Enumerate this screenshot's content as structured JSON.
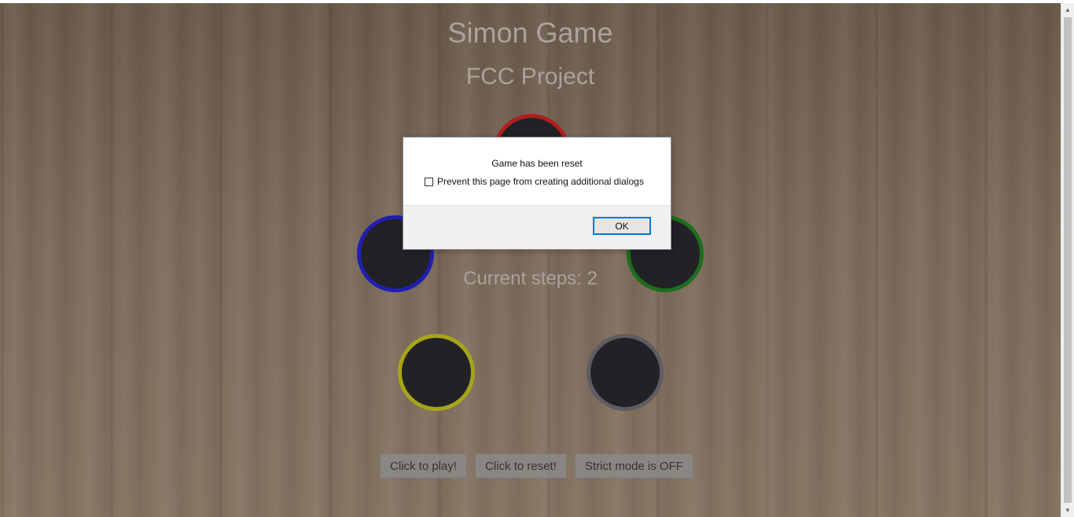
{
  "game": {
    "title": "Simon Game",
    "subtitle": "FCC Project",
    "steps_label": "Current steps: ",
    "steps_value": "2",
    "pads": [
      {
        "color": "red",
        "hex": "#b01e1e"
      },
      {
        "color": "blue",
        "hex": "#2020b0"
      },
      {
        "color": "green",
        "hex": "#1d6e1d"
      },
      {
        "color": "yellow",
        "hex": "#a5a51a"
      },
      {
        "color": "gray",
        "hex": "#5d5d62"
      }
    ]
  },
  "controls": {
    "play_label": "Click to play!",
    "reset_label": "Click to reset!",
    "strict_label": "Strict mode is OFF"
  },
  "dialog": {
    "message": "Game has been reset",
    "checkbox_label": "Prevent this page from creating additional dialogs",
    "checkbox_checked": false,
    "ok_label": "OK"
  },
  "scrollbar": {
    "up_icon": "triangle-up",
    "down_icon": "triangle-down"
  }
}
